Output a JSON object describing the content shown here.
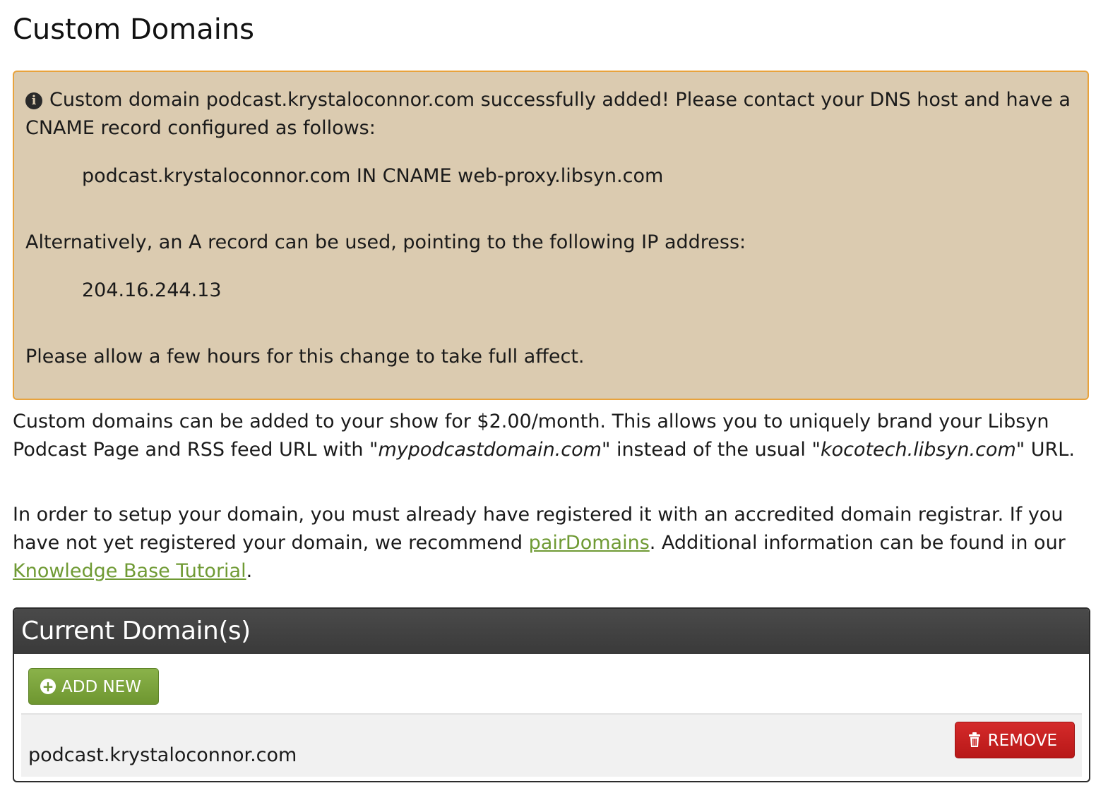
{
  "page": {
    "title": "Custom Domains"
  },
  "alert": {
    "icon": "info-icon",
    "line1": "Custom domain podcast.krystaloconnor.com successfully added! Please contact your DNS host and have a CNAME record configured as follows:",
    "cname_record": "podcast.krystaloconnor.com IN CNAME web-proxy.libsyn.com",
    "alt_text": "Alternatively, an A record can be used, pointing to the following IP address:",
    "ip_address": "204.16.244.13",
    "note": "Please allow a few hours for this change to take full affect."
  },
  "intro": {
    "p1_before": "Custom domains can be added to your show for $2.00/month. This allows you to uniquely brand your Libsyn Podcast Page and RSS feed URL with \"",
    "p1_example_domain": "mypodcastdomain.com",
    "p1_middle": "\" instead of the usual \"",
    "p1_default_domain": "kocotech.libsyn.com",
    "p1_after": "\" URL.",
    "p2_before": "In order to setup your domain, you must already have registered it with an accredited domain registrar. If you have not yet registered your domain, we recommend ",
    "p2_link1": "pairDomains",
    "p2_middle": ". Additional information can be found in our ",
    "p2_link2": "Knowledge Base Tutorial",
    "p2_after": "."
  },
  "panel": {
    "title": "Current Domain(s)",
    "add_label": "ADD NEW",
    "domains": [
      {
        "name": "podcast.krystaloconnor.com",
        "remove_label": "REMOVE"
      }
    ]
  },
  "colors": {
    "alert_bg": "#dbcbb0",
    "alert_border": "#e8a33d",
    "link": "#6f9a34",
    "add_button": "#7aa33c",
    "remove_button": "#c82020",
    "panel_header": "#404040"
  }
}
